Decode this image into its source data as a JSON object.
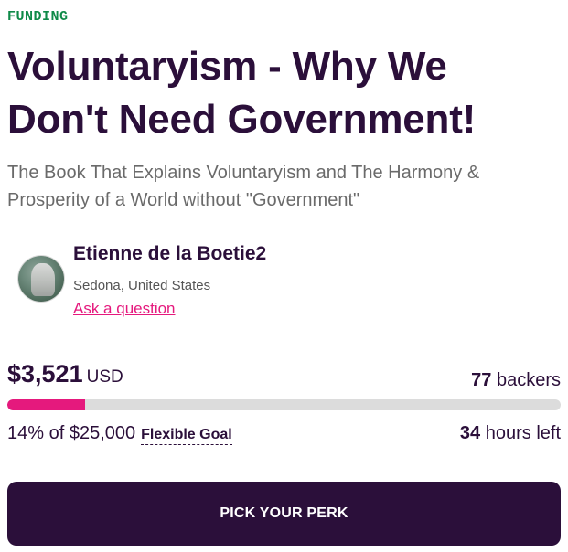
{
  "header": {
    "category_label": "FUNDING",
    "title": "Voluntaryism - Why We Don't Need Government!",
    "subtitle": "The Book That Explains Voluntaryism and The Harmony & Prosperity of a World without \"Government\""
  },
  "owner": {
    "name": "Etienne de la Boetie2",
    "location": "Sedona, United States",
    "ask_link": "Ask a question",
    "avatar_icon": "avatar-photo-icon"
  },
  "funding": {
    "raised_amount": "$3,521",
    "currency": "USD",
    "backers_count": "77",
    "backers_label": "backers",
    "percent_funded": 14,
    "goal_text": "14% of $25,000",
    "goal_type": "Flexible Goal",
    "time_left_value": "34",
    "time_left_label": "hours left",
    "accent_color": "#e5197d"
  },
  "cta": {
    "button_label": "PICK YOUR PERK"
  },
  "colors": {
    "brand_dark": "#2b0f3a",
    "funding_label": "#0f8a48",
    "accent": "#e5197d",
    "track": "#dcdcdc"
  }
}
